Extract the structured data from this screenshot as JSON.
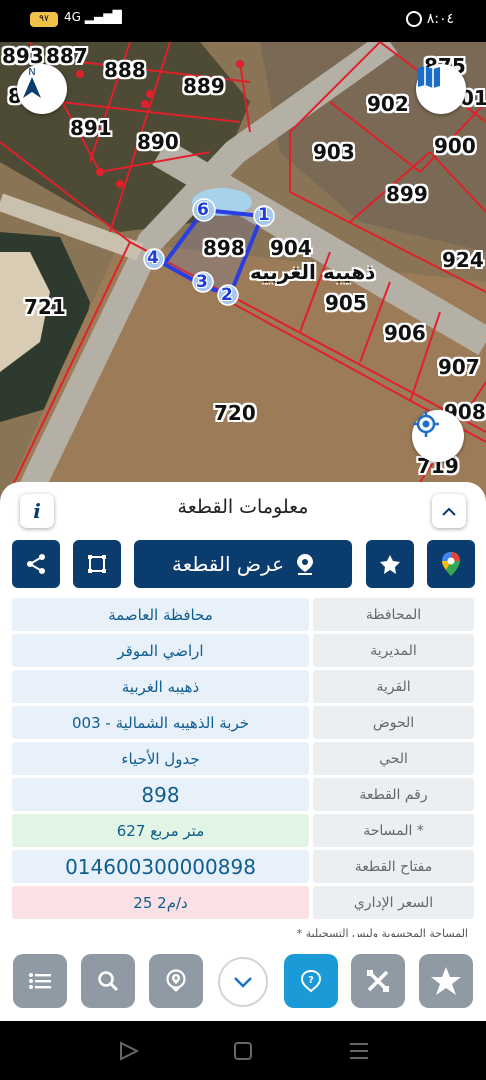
{
  "status_bar": {
    "time": "٨:٠٤",
    "battery": "٩٧",
    "network": "4G"
  },
  "map": {
    "parcel_numbers": [
      "893",
      "887",
      "888",
      "889",
      "8",
      "891",
      "890",
      "875",
      "902",
      "01",
      "903",
      "900",
      "899",
      "898",
      "904",
      "924",
      "721",
      "905",
      "906",
      "907",
      "720",
      "908",
      "719"
    ],
    "village_label": "ذهيبه الغربيه",
    "vertices": [
      "1",
      "2",
      "3",
      "4",
      "6"
    ],
    "colors": {
      "parcel_line": "#e0202a",
      "selection": "#2a3de0",
      "road": "#a9a9a9"
    }
  },
  "sheet": {
    "title": "معلومات القطعة",
    "info_icon": "i",
    "actions": {
      "view_parcel": "عرض القطعة"
    },
    "rows": [
      {
        "label": "المحافظة",
        "value": "محافظة العاصمة"
      },
      {
        "label": "المديرية",
        "value": "اراضي الموقر"
      },
      {
        "label": "القرية",
        "value": "ذهيبه الغربية"
      },
      {
        "label": "الحوض",
        "value": "خربة الذهيبه الشمالية - 003"
      },
      {
        "label": "الحي",
        "value": "جدول الأحياء"
      },
      {
        "label": "رقم القطعة",
        "value": "898"
      },
      {
        "label": "المساحة *",
        "value": "627  متر مربع"
      },
      {
        "label": "مفتاح القطعة",
        "value": "014600300000898"
      },
      {
        "label": "السعر الإداري",
        "value": "25 د/م2"
      }
    ],
    "footnote": "* المساحة المحسوبة وليس التسجيلية"
  },
  "toolbar": {
    "icons": [
      "list-icon",
      "search-icon",
      "pin-icon",
      "chevron-down-icon",
      "help-icon",
      "tools-icon",
      "star-icon"
    ]
  }
}
